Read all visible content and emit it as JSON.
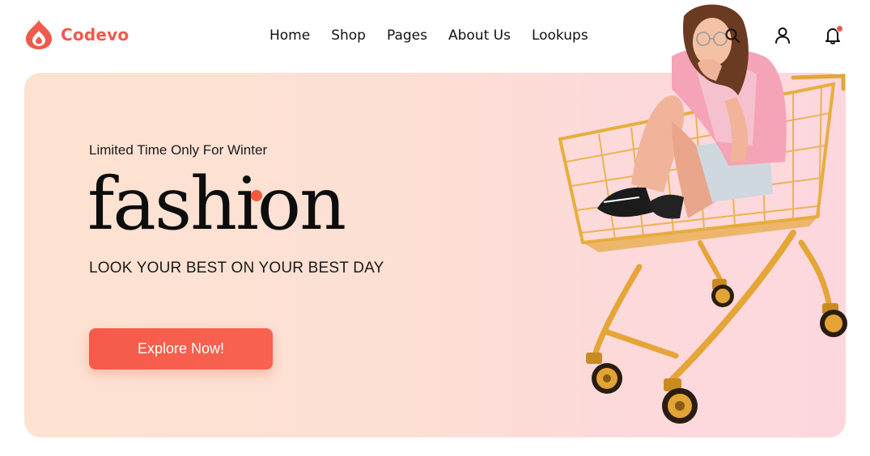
{
  "brand": {
    "name": "Codevo",
    "accent": "#f05a4b"
  },
  "nav": {
    "items": [
      {
        "label": "Home"
      },
      {
        "label": "Shop"
      },
      {
        "label": "Pages"
      },
      {
        "label": "About Us"
      },
      {
        "label": "Lookups"
      }
    ]
  },
  "header_icons": [
    "search-icon",
    "user-icon",
    "bell-icon"
  ],
  "hero": {
    "tagline": "Limited Time Only For Winter",
    "headline": "fashion",
    "subline": "LOOK YOUR BEST ON YOUR BEST DAY",
    "cta_label": "Explore Now!",
    "background_start": "#fde2d2",
    "background_end": "#fdd7de"
  }
}
